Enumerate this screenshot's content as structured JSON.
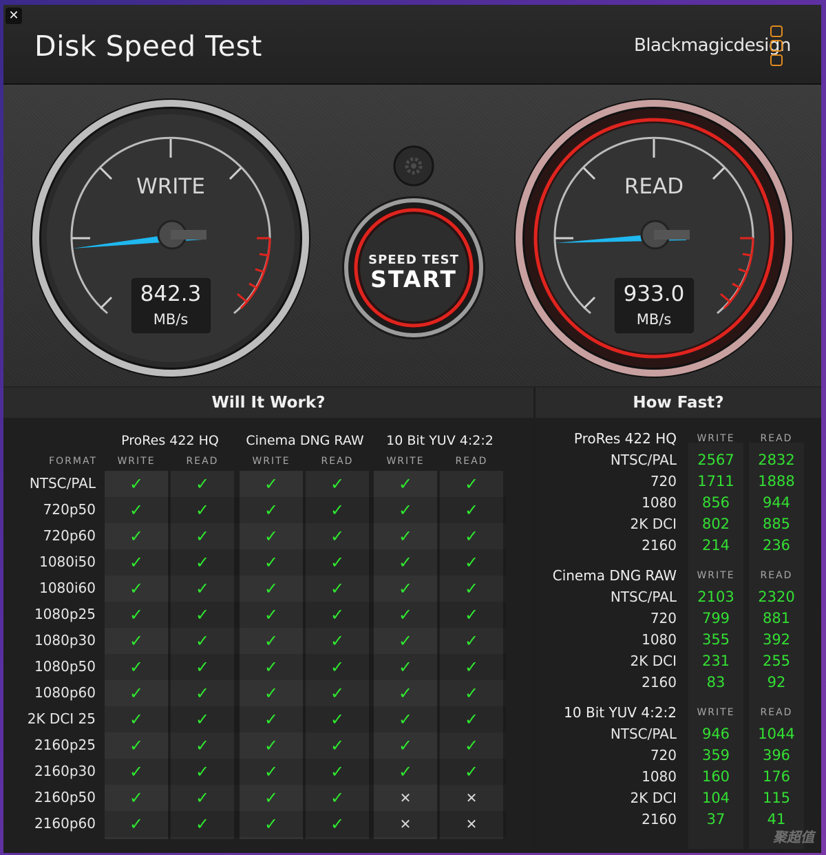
{
  "app": {
    "title": "Disk Speed Test",
    "brand": "Blackmagicdesign",
    "close_icon": "close-icon"
  },
  "write_gauge": {
    "label": "WRITE",
    "value": "842.3",
    "unit": "MB/s",
    "needle_fraction": 0.08
  },
  "read_gauge": {
    "label": "READ",
    "value": "933.0",
    "unit": "MB/s",
    "needle_fraction": 0.07
  },
  "start_button": {
    "line1": "SPEED TEST",
    "line2": "START"
  },
  "settings_icon": "gear-icon",
  "will_it_work": {
    "title": "Will It Work?",
    "format_header": "FORMAT",
    "groups": [
      {
        "name": "ProRes 422 HQ",
        "write": "WRITE",
        "read": "READ"
      },
      {
        "name": "Cinema DNG RAW",
        "write": "WRITE",
        "read": "READ"
      },
      {
        "name": "10 Bit YUV 4:2:2",
        "write": "WRITE",
        "read": "READ"
      }
    ],
    "rows": [
      {
        "format": "NTSC/PAL",
        "cells": [
          1,
          1,
          1,
          1,
          1,
          1
        ]
      },
      {
        "format": "720p50",
        "cells": [
          1,
          1,
          1,
          1,
          1,
          1
        ]
      },
      {
        "format": "720p60",
        "cells": [
          1,
          1,
          1,
          1,
          1,
          1
        ]
      },
      {
        "format": "1080i50",
        "cells": [
          1,
          1,
          1,
          1,
          1,
          1
        ]
      },
      {
        "format": "1080i60",
        "cells": [
          1,
          1,
          1,
          1,
          1,
          1
        ]
      },
      {
        "format": "1080p25",
        "cells": [
          1,
          1,
          1,
          1,
          1,
          1
        ]
      },
      {
        "format": "1080p30",
        "cells": [
          1,
          1,
          1,
          1,
          1,
          1
        ]
      },
      {
        "format": "1080p50",
        "cells": [
          1,
          1,
          1,
          1,
          1,
          1
        ]
      },
      {
        "format": "1080p60",
        "cells": [
          1,
          1,
          1,
          1,
          1,
          1
        ]
      },
      {
        "format": "2K DCI 25",
        "cells": [
          1,
          1,
          1,
          1,
          1,
          1
        ]
      },
      {
        "format": "2160p25",
        "cells": [
          1,
          1,
          1,
          1,
          1,
          1
        ]
      },
      {
        "format": "2160p30",
        "cells": [
          1,
          1,
          1,
          1,
          1,
          1
        ]
      },
      {
        "format": "2160p50",
        "cells": [
          1,
          1,
          1,
          1,
          0,
          0
        ]
      },
      {
        "format": "2160p60",
        "cells": [
          1,
          1,
          1,
          1,
          0,
          0
        ]
      }
    ],
    "ok_glyph": "✓",
    "no_glyph": "✕"
  },
  "how_fast": {
    "title": "How Fast?",
    "groups": [
      {
        "name": "ProRes 422 HQ",
        "write": "WRITE",
        "read": "READ",
        "rows": [
          {
            "label": "NTSC/PAL",
            "write": "2567",
            "read": "2832"
          },
          {
            "label": "720",
            "write": "1711",
            "read": "1888"
          },
          {
            "label": "1080",
            "write": "856",
            "read": "944"
          },
          {
            "label": "2K DCI",
            "write": "802",
            "read": "885"
          },
          {
            "label": "2160",
            "write": "214",
            "read": "236"
          }
        ]
      },
      {
        "name": "Cinema DNG RAW",
        "write": "WRITE",
        "read": "READ",
        "rows": [
          {
            "label": "NTSC/PAL",
            "write": "2103",
            "read": "2320"
          },
          {
            "label": "720",
            "write": "799",
            "read": "881"
          },
          {
            "label": "1080",
            "write": "355",
            "read": "392"
          },
          {
            "label": "2K DCI",
            "write": "231",
            "read": "255"
          },
          {
            "label": "2160",
            "write": "83",
            "read": "92"
          }
        ]
      },
      {
        "name": "10 Bit YUV 4:2:2",
        "write": "WRITE",
        "read": "READ",
        "rows": [
          {
            "label": "NTSC/PAL",
            "write": "946",
            "read": "1044"
          },
          {
            "label": "720",
            "write": "359",
            "read": "396"
          },
          {
            "label": "1080",
            "write": "160",
            "read": "176"
          },
          {
            "label": "2K DCI",
            "write": "104",
            "read": "115"
          },
          {
            "label": "2160",
            "write": "37",
            "read": "41"
          }
        ]
      }
    ]
  },
  "watermark": "聚超值",
  "colors": {
    "needle": "#1fb8f0",
    "red_ring": "#e0241e",
    "ok": "#2fe82f",
    "value": "#33e033"
  }
}
